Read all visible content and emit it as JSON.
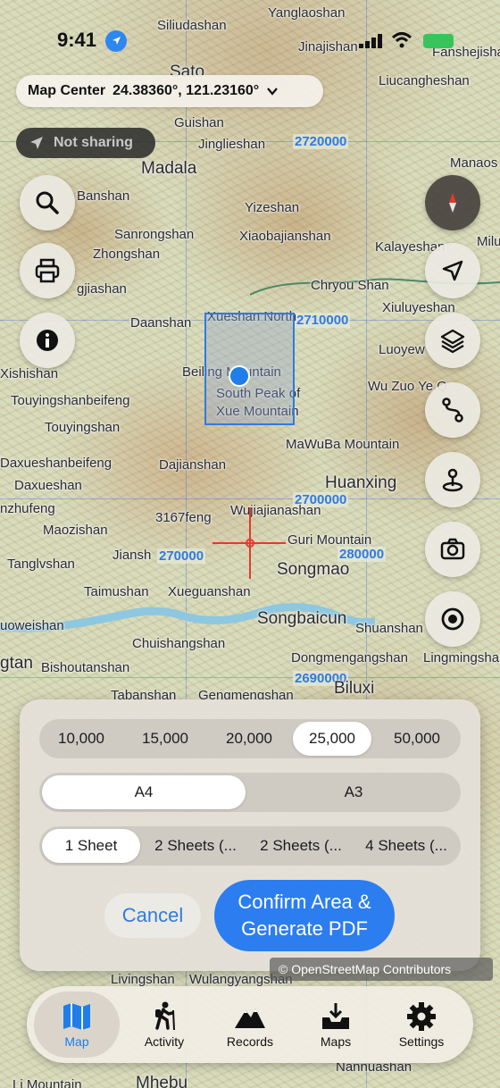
{
  "status_bar": {
    "time": "9:41"
  },
  "map_center": {
    "label": "Map Center",
    "coords": "24.38360°, 121.23160°"
  },
  "sharing": {
    "label": "Not sharing"
  },
  "grid_labels": [
    "2720000",
    "2710000",
    "2700000",
    "270000",
    "280000",
    "2690000"
  ],
  "places": [
    {
      "name": "Yanglaoshan"
    },
    {
      "name": "Siliudashan"
    },
    {
      "name": "Jinajishan"
    },
    {
      "name": "Fanshejishan"
    },
    {
      "name": "Sato"
    },
    {
      "name": "Liucangheshan"
    },
    {
      "name": "Guishan"
    },
    {
      "name": "Jinglieshan"
    },
    {
      "name": "Manaos"
    },
    {
      "name": "Madala"
    },
    {
      "name": "Banshan"
    },
    {
      "name": "Yizeshan"
    },
    {
      "name": "Sanrongshan"
    },
    {
      "name": "Xiaobajianshan"
    },
    {
      "name": "Kalayeshan"
    },
    {
      "name": "Milu"
    },
    {
      "name": "Zhongshan"
    },
    {
      "name": "Chryou Shan"
    },
    {
      "name": "gjiashan"
    },
    {
      "name": "Xiuluyeshan"
    },
    {
      "name": "Daanshan"
    },
    {
      "name": "Xueshan North"
    },
    {
      "name": "Luoyew"
    },
    {
      "name": "Xishishan"
    },
    {
      "name": "Beiling Mountain"
    },
    {
      "name": "South Peak of"
    },
    {
      "name": "Xue Mountain"
    },
    {
      "name": "Wu Zuo Ye Q"
    },
    {
      "name": "Touyingshanbeifeng"
    },
    {
      "name": "Touyingshan"
    },
    {
      "name": "MaWuBa Mountain"
    },
    {
      "name": "Daxueshanbeifeng"
    },
    {
      "name": "Dajianshan"
    },
    {
      "name": "Daxueshan"
    },
    {
      "name": "Huanxing"
    },
    {
      "name": "nzhufeng"
    },
    {
      "name": "Wujiajianashan"
    },
    {
      "name": "3167feng"
    },
    {
      "name": "Maozishan"
    },
    {
      "name": "Guri Mountain"
    },
    {
      "name": "Jiansh"
    },
    {
      "name": "Tanglvshan"
    },
    {
      "name": "Songmao"
    },
    {
      "name": "Taimushan"
    },
    {
      "name": "Xueguanshan"
    },
    {
      "name": "Songbaicun"
    },
    {
      "name": "Shuanshan"
    },
    {
      "name": "uoweishan"
    },
    {
      "name": "Chuishangshan"
    },
    {
      "name": "Dongmengangshan"
    },
    {
      "name": "Lingmingshan"
    },
    {
      "name": "gtan"
    },
    {
      "name": "Bishoutanshan"
    },
    {
      "name": "Tabanshan"
    },
    {
      "name": "Gengmengshan"
    },
    {
      "name": "Biluxi"
    },
    {
      "name": "Livingshan"
    },
    {
      "name": "Wulangyangshan"
    },
    {
      "name": "Nannuashan"
    },
    {
      "name": "Mhebu"
    },
    {
      "name": "Li Mountain"
    }
  ],
  "print_panel": {
    "scales": [
      "10,000",
      "15,000",
      "20,000",
      "25,000",
      "50,000"
    ],
    "selected_scale": "25,000",
    "paper_sizes": [
      "A4",
      "A3"
    ],
    "selected_paper": "A4",
    "sheet_options": [
      "1 Sheet",
      "2 Sheets (...",
      "2 Sheets (...",
      "4 Sheets (..."
    ],
    "selected_sheet": "1 Sheet",
    "cancel_label": "Cancel",
    "confirm_label": "Confirm Area & Generate PDF"
  },
  "attribution": "© OpenStreetMap Contributors",
  "tabs": [
    {
      "label": "Map",
      "icon": "map-icon",
      "selected": true
    },
    {
      "label": "Activity",
      "icon": "hiker-icon",
      "selected": false
    },
    {
      "label": "Records",
      "icon": "mountains-icon",
      "selected": false
    },
    {
      "label": "Maps",
      "icon": "tray-download-icon",
      "selected": false
    },
    {
      "label": "Settings",
      "icon": "gear-icon",
      "selected": false
    }
  ],
  "colors": {
    "accent": "#2c7df0",
    "crosshair": "#e23a2e",
    "grid": "#2f7be0"
  }
}
